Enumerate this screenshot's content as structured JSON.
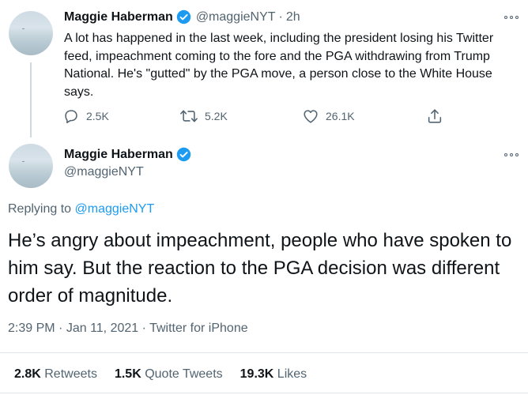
{
  "tweet1": {
    "display_name": "Maggie Haberman",
    "handle": "@maggieNYT",
    "separator": "·",
    "time": "2h",
    "text": "A lot has happened in the last week, including the president losing his Twitter feed, impeachment coming to the fore and the PGA withdrawing from Trump National. He's \"gutted\" by the PGA move, a person close to the White House says.",
    "actions": {
      "reply_count": "2.5K",
      "retweet_count": "5.2K",
      "like_count": "26.1K"
    },
    "icons": [
      "verified-badge-icon",
      "more-icon",
      "reply-icon",
      "retweet-icon",
      "like-icon",
      "share-icon"
    ]
  },
  "tweet2": {
    "display_name": "Maggie Haberman",
    "handle": "@maggieNYT",
    "replying_prefix": "Replying to ",
    "replying_handle": "@maggieNYT",
    "text": "He’s angry about impeachment, people who have spoken to him say. But the reaction to the PGA decision was different order of magnitude.",
    "time": "2:39 PM",
    "date": "Jan 11, 2021",
    "source": "Twitter for iPhone",
    "dot": "·"
  },
  "stats": {
    "retweets_count": "2.8K",
    "retweets_label": "Retweets",
    "quote_count": "1.5K",
    "quote_label": "Quote Tweets",
    "likes_count": "19.3K",
    "likes_label": "Likes"
  },
  "colors": {
    "accent": "#1d9bf0",
    "text": "#0f1419",
    "secondary": "#536471",
    "divider": "#dfe5e8"
  }
}
